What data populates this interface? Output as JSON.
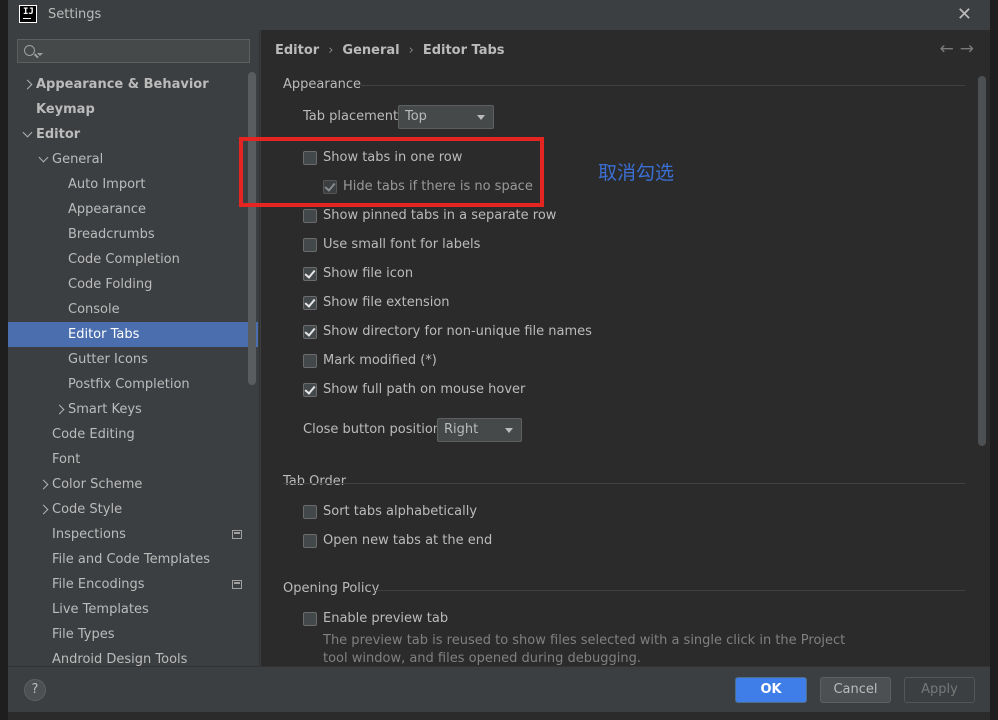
{
  "window": {
    "title": "Settings",
    "logo_text": "IJ"
  },
  "search": {
    "placeholder": ""
  },
  "tree": [
    {
      "label": "Appearance & Behavior",
      "level": 0,
      "chevron": "right",
      "bold": true
    },
    {
      "label": "Keymap",
      "level": 0,
      "chevron": "none",
      "bold": true
    },
    {
      "label": "Editor",
      "level": 0,
      "chevron": "down",
      "bold": true
    },
    {
      "label": "General",
      "level": 1,
      "chevron": "down"
    },
    {
      "label": "Auto Import",
      "level": 2,
      "chevron": "none"
    },
    {
      "label": "Appearance",
      "level": 2,
      "chevron": "none"
    },
    {
      "label": "Breadcrumbs",
      "level": 2,
      "chevron": "none"
    },
    {
      "label": "Code Completion",
      "level": 2,
      "chevron": "none"
    },
    {
      "label": "Code Folding",
      "level": 2,
      "chevron": "none"
    },
    {
      "label": "Console",
      "level": 2,
      "chevron": "none"
    },
    {
      "label": "Editor Tabs",
      "level": 2,
      "chevron": "none",
      "selected": true
    },
    {
      "label": "Gutter Icons",
      "level": 2,
      "chevron": "none"
    },
    {
      "label": "Postfix Completion",
      "level": 2,
      "chevron": "none"
    },
    {
      "label": "Smart Keys",
      "level": 2,
      "chevron": "right"
    },
    {
      "label": "Code Editing",
      "level": 1,
      "chevron": "none"
    },
    {
      "label": "Font",
      "level": 1,
      "chevron": "none"
    },
    {
      "label": "Color Scheme",
      "level": 1,
      "chevron": "right"
    },
    {
      "label": "Code Style",
      "level": 1,
      "chevron": "right"
    },
    {
      "label": "Inspections",
      "level": 1,
      "chevron": "none",
      "project_icon": true
    },
    {
      "label": "File and Code Templates",
      "level": 1,
      "chevron": "none"
    },
    {
      "label": "File Encodings",
      "level": 1,
      "chevron": "none",
      "project_icon": true
    },
    {
      "label": "Live Templates",
      "level": 1,
      "chevron": "none"
    },
    {
      "label": "File Types",
      "level": 1,
      "chevron": "none"
    },
    {
      "label": "Android Design Tools",
      "level": 1,
      "chevron": "none"
    }
  ],
  "breadcrumb": {
    "part1": "Editor",
    "part2": "General",
    "part3": "Editor Tabs",
    "separator": "›"
  },
  "nav": {
    "back": "←",
    "forward": "→"
  },
  "sections": {
    "appearance": "Appearance",
    "tab_order": "Tab Order",
    "opening_policy": "Opening Policy"
  },
  "tab_placement": {
    "label": "Tab placement:",
    "value": "Top"
  },
  "close_button_position": {
    "label": "Close button position:",
    "value": "Right"
  },
  "checkboxes": {
    "show_tabs_one_row": {
      "label": "Show tabs in one row",
      "checked": false
    },
    "hide_tabs_no_space": {
      "label": "Hide tabs if there is no space",
      "checked": true,
      "disabled": true
    },
    "pinned_separate_row": {
      "label": "Show pinned tabs in a separate row",
      "checked": false
    },
    "small_font": {
      "label": "Use small font for labels",
      "checked": false
    },
    "file_icon": {
      "label": "Show file icon",
      "checked": true
    },
    "file_extension": {
      "label": "Show file extension",
      "checked": true
    },
    "directory_nonunique": {
      "label": "Show directory for non-unique file names",
      "checked": true
    },
    "mark_modified": {
      "label": "Mark modified (*)",
      "checked": false
    },
    "full_path_hover": {
      "label": "Show full path on mouse hover",
      "checked": true
    },
    "sort_alpha": {
      "label": "Sort tabs alphabetically",
      "checked": false
    },
    "open_at_end": {
      "label": "Open new tabs at the end",
      "checked": false
    },
    "preview_tab": {
      "label": "Enable preview tab",
      "checked": false
    }
  },
  "preview_desc": {
    "line1": "The preview tab is reused to show files selected with a single click in the Project",
    "line2": "tool window, and files opened during debugging."
  },
  "annotation": {
    "text": "取消勾选",
    "color": "#3b6fd4",
    "box_color": "#e52521"
  },
  "buttons": {
    "help": "?",
    "ok": "OK",
    "cancel": "Cancel",
    "apply": "Apply"
  },
  "colors": {
    "selected": "#4b6eaf",
    "ok_button": "#3f7ee8"
  }
}
